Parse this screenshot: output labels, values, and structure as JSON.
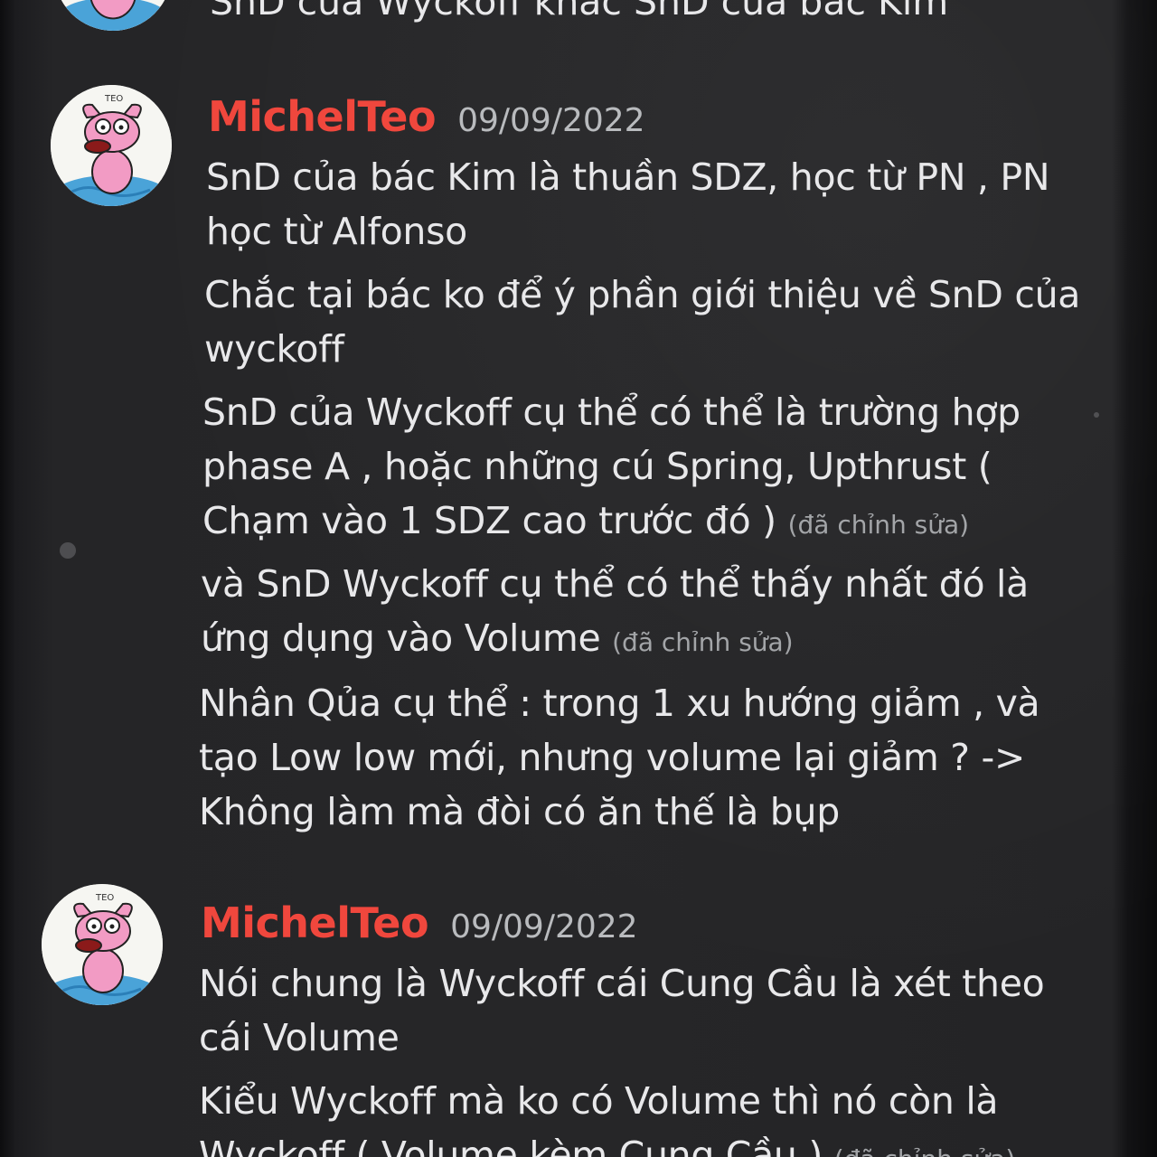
{
  "previous_message": {
    "text": "SnD của Wyckoff khác SnD của bác Kim"
  },
  "messages": [
    {
      "username": "MichelTeo",
      "timestamp": "09/09/2022",
      "avatar_label": "TEO",
      "lines": [
        {
          "text": "SnD của bác Kim là thuần SDZ, học từ PN , PN học từ Alfonso",
          "edited": ""
        },
        {
          "text": "Chắc tại bác ko để ý phần giới thiệu về SnD của wyckoff",
          "edited": ""
        },
        {
          "text": "SnD của Wyckoff cụ thể có thể là trường hợp phase A , hoặc những cú Spring, Upthrust ( Chạm vào 1 SDZ cao trước đó )",
          "edited": "(đã chỉnh sửa)"
        },
        {
          "text": "và SnD Wyckoff cụ thể có thể thấy nhất đó là ứng dụng vào Volume",
          "edited": "(đã chỉnh sửa)"
        },
        {
          "text": "Nhân Qủa cụ thể : trong 1 xu hướng giảm ,  và tạo Low low mới, nhưng volume lại giảm ? -> Không làm mà đòi có ăn thế là bụp",
          "edited": ""
        }
      ]
    },
    {
      "username": "MichelTeo",
      "timestamp": "09/09/2022",
      "avatar_label": "TEO",
      "lines": [
        {
          "text": "Nói chung là Wyckoff cái Cung Cầu là xét theo cái Volume",
          "edited": ""
        },
        {
          "text": "Kiểu Wyckoff mà ko có Volume thì nó còn là Wyckoff ( Volume kèm Cung Cầu )",
          "edited": "(đã chỉnh sửa)"
        }
      ]
    }
  ],
  "colors": {
    "background": "#262628",
    "username": "#f0473d",
    "timestamp": "#b9bbbe",
    "message_text": "#e8e8ea",
    "edited_text": "#a3a5a8"
  },
  "icons": [
    "courage-dog-avatar"
  ]
}
